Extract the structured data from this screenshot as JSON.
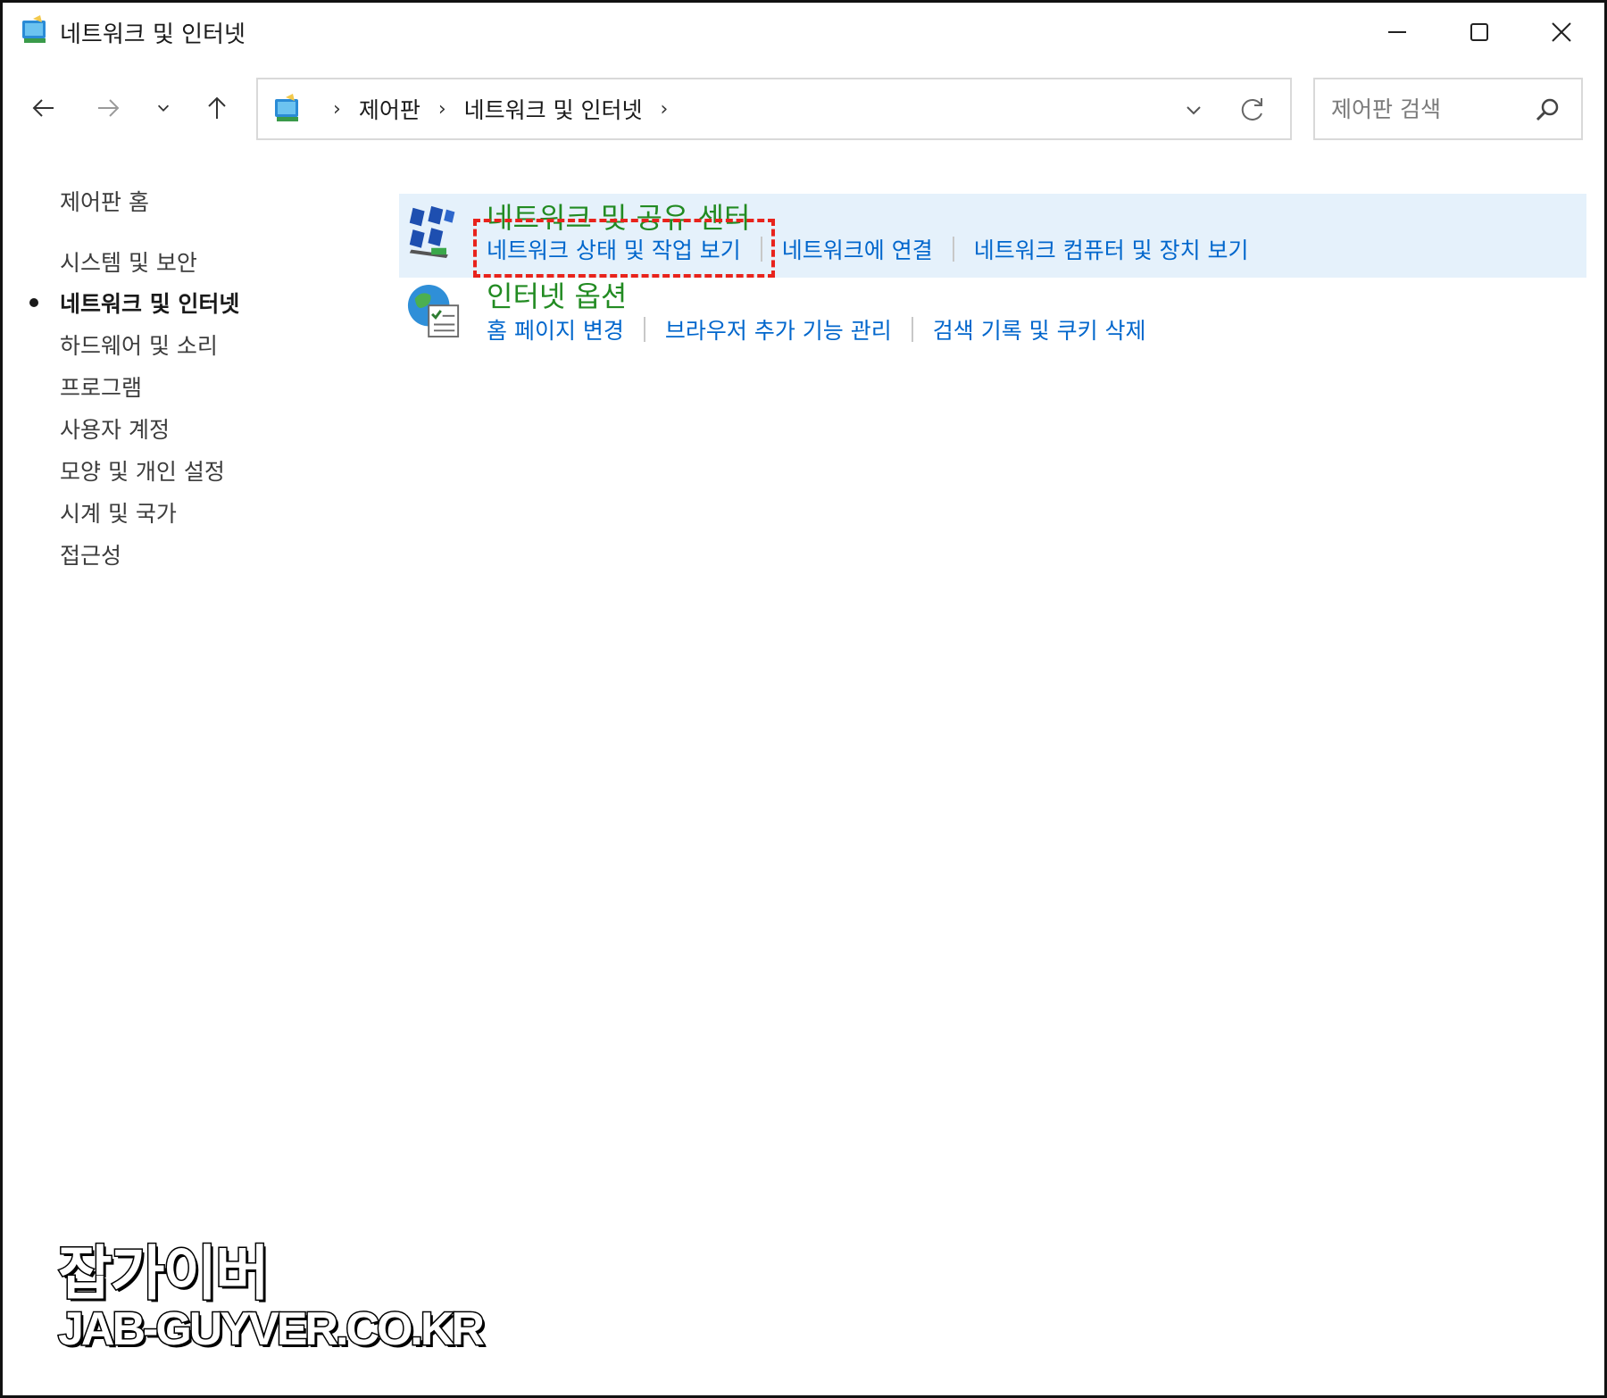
{
  "window": {
    "title": "네트워크 및 인터넷",
    "icon": "control-panel-icon"
  },
  "titlebar_controls": {
    "minimize_icon": "minimize-icon",
    "maximize_icon": "maximize-icon",
    "close_icon": "close-icon"
  },
  "nav": {
    "back_icon": "arrow-left-icon",
    "forward_icon": "arrow-right-icon",
    "recent_icon": "chevron-down-icon",
    "up_icon": "arrow-up-icon",
    "breadcrumbs": [
      "제어판",
      "네트워크 및 인터넷"
    ],
    "separator": "›",
    "search_placeholder": "제어판 검색"
  },
  "sidebar": {
    "items": [
      {
        "label": "제어판 홈",
        "active": false
      },
      {
        "label": "시스템 및 보안",
        "active": false
      },
      {
        "label": "네트워크 및 인터넷",
        "active": true
      },
      {
        "label": "하드웨어 및 소리",
        "active": false
      },
      {
        "label": "프로그램",
        "active": false
      },
      {
        "label": "사용자 계정",
        "active": false
      },
      {
        "label": "모양 및 개인 설정",
        "active": false
      },
      {
        "label": "시계 및 국가",
        "active": false
      },
      {
        "label": "접근성",
        "active": false
      }
    ]
  },
  "categories": [
    {
      "title": "네트워크 및 공유 센터",
      "icon": "network-sharing-icon",
      "highlighted": true,
      "links": [
        "네트워크 상태 및 작업 보기",
        "네트워크에 연결",
        "네트워크 컴퓨터 및 장치 보기"
      ]
    },
    {
      "title": "인터넷 옵션",
      "icon": "internet-options-icon",
      "highlighted": false,
      "links": [
        "홈 페이지 변경",
        "브라우저 추가 기능 관리",
        "검색 기록 및 쿠키 삭제"
      ]
    }
  ],
  "annotation": {
    "color": "#e8231c",
    "target": "네트워크 상태 및 작업 보기"
  },
  "watermark": {
    "line1": "잡가이버",
    "line2": "JAB-GUYVER.CO.KR"
  },
  "colors": {
    "link": "#0066cc",
    "category_title": "#228b22",
    "highlight_bg": "#e5f1fb"
  }
}
